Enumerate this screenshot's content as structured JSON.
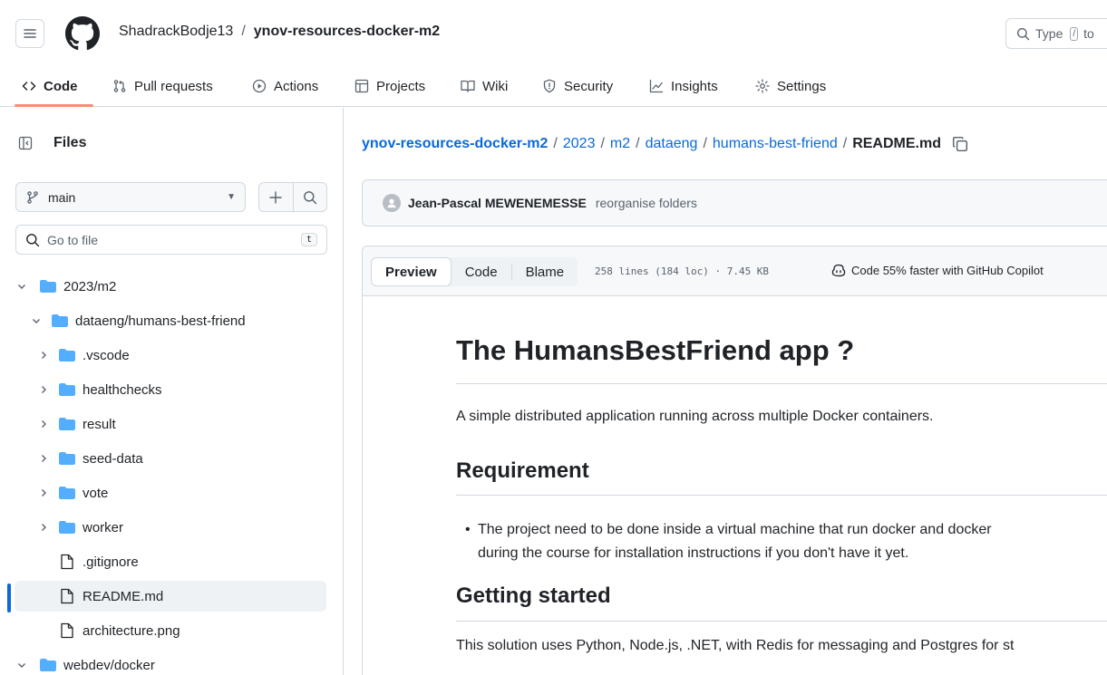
{
  "header": {
    "owner": "ShadrackBodje13",
    "separator": "/",
    "repo": "ynov-resources-docker-m2",
    "search_placeholder": "Type",
    "search_slash": "/",
    "search_tail": "to"
  },
  "tabs": [
    {
      "label": "Code",
      "icon": "code-icon"
    },
    {
      "label": "Pull requests",
      "icon": "pull-request-icon"
    },
    {
      "label": "Actions",
      "icon": "play-circle-icon"
    },
    {
      "label": "Projects",
      "icon": "table-icon"
    },
    {
      "label": "Wiki",
      "icon": "book-icon"
    },
    {
      "label": "Security",
      "icon": "shield-icon"
    },
    {
      "label": "Insights",
      "icon": "graph-icon"
    },
    {
      "label": "Settings",
      "icon": "gear-icon"
    }
  ],
  "sidebar": {
    "title": "Files",
    "branch": "main",
    "goto_placeholder": "Go to file",
    "goto_shortcut": "t",
    "tree": [
      {
        "label": "2023/m2",
        "type": "folder",
        "expanded": true,
        "depth": 0
      },
      {
        "label": "dataeng/humans-best-friend",
        "type": "folder",
        "expanded": true,
        "depth": 1
      },
      {
        "label": ".vscode",
        "type": "folder",
        "expanded": false,
        "depth": 2
      },
      {
        "label": "healthchecks",
        "type": "folder",
        "expanded": false,
        "depth": 2
      },
      {
        "label": "result",
        "type": "folder",
        "expanded": false,
        "depth": 2
      },
      {
        "label": "seed-data",
        "type": "folder",
        "expanded": false,
        "depth": 2
      },
      {
        "label": "vote",
        "type": "folder",
        "expanded": false,
        "depth": 2
      },
      {
        "label": "worker",
        "type": "folder",
        "expanded": false,
        "depth": 2
      },
      {
        "label": ".gitignore",
        "type": "file",
        "depth": 2
      },
      {
        "label": "README.md",
        "type": "file",
        "depth": 2,
        "selected": true
      },
      {
        "label": "architecture.png",
        "type": "file",
        "depth": 2
      },
      {
        "label": "webdev/docker",
        "type": "folder",
        "expanded": true,
        "depth": 0
      }
    ]
  },
  "breadcrumb": {
    "items": [
      "ynov-resources-docker-m2",
      "2023",
      "m2",
      "dataeng",
      "humans-best-friend"
    ],
    "current": "README.md"
  },
  "commit": {
    "author": "Jean-Pascal MEWENEMESSE",
    "message": "reorganise folders"
  },
  "file_header": {
    "preview": "Preview",
    "code": "Code",
    "blame": "Blame",
    "meta": "258 lines (184 loc) · 7.45 KB",
    "copilot": "Code 55% faster with GitHub Copilot"
  },
  "readme": {
    "title": "The HumansBestFriend app ?",
    "intro": "A simple distributed application running across multiple Docker containers.",
    "h_requirement": "Requirement",
    "requirement_line1": "The project need to be done inside a virtual machine that run docker and docker",
    "requirement_line2": "during the course for installation instructions if you don't have it yet.",
    "h_getting_started": "Getting started",
    "getting_started_text": "This solution uses Python, Node.js, .NET, with Redis for messaging and Postgres for st"
  },
  "colors": {
    "link": "#0969da",
    "tab_underline": "#fd8c73",
    "folder": "#54aeff",
    "border": "#d1d9e0",
    "muted": "#59636e"
  }
}
